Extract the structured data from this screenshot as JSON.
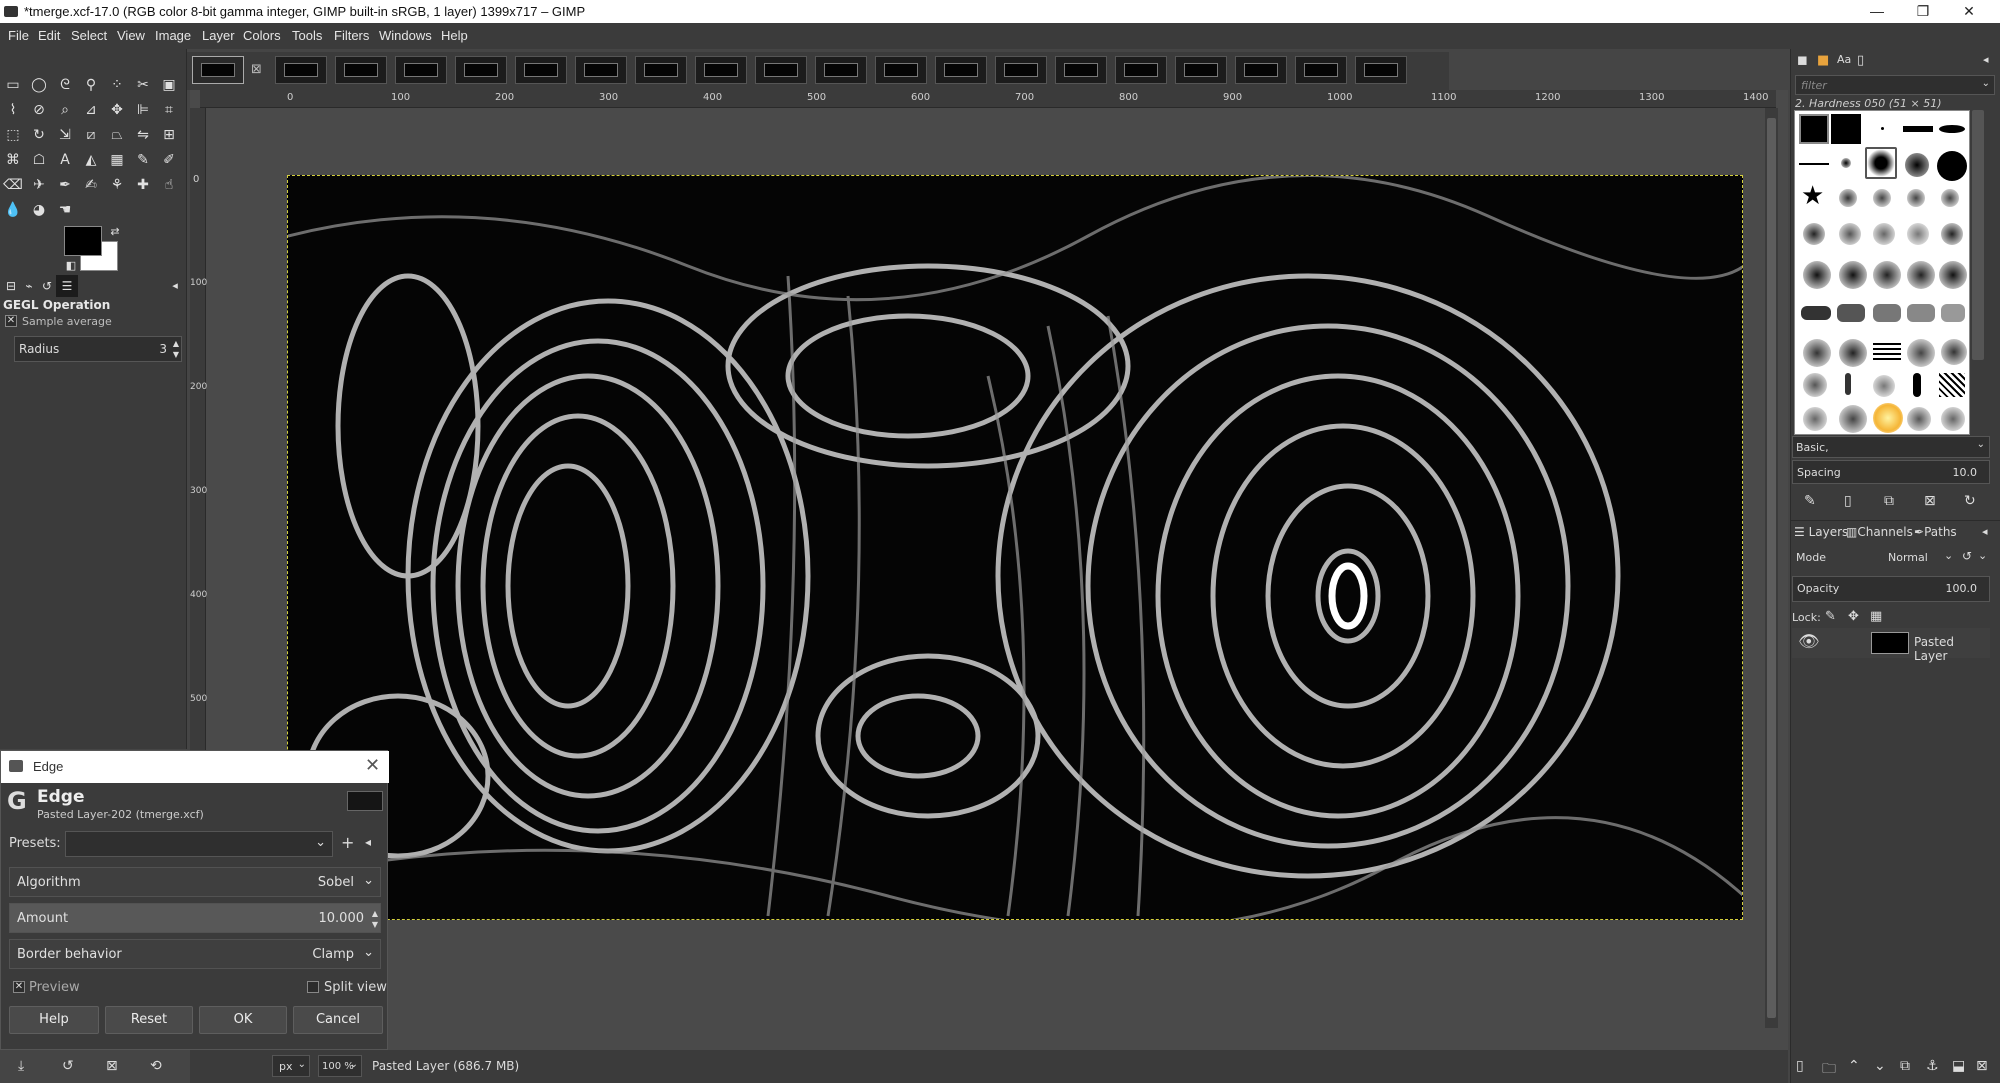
{
  "window": {
    "title": "*tmerge.xcf-17.0 (RGB color 8-bit gamma integer, GIMP built-in sRGB, 1 layer) 1399x717 – GIMP"
  },
  "menubar": [
    "File",
    "Edit",
    "Select",
    "View",
    "Image",
    "Layer",
    "Colors",
    "Tools",
    "Filters",
    "Windows",
    "Help"
  ],
  "ruler": {
    "h": [
      "0",
      "100",
      "200",
      "300",
      "400",
      "500",
      "600",
      "700",
      "800",
      "900",
      "1000",
      "1100",
      "1200",
      "1300",
      "1400"
    ],
    "v": [
      "0",
      "100",
      "200",
      "300",
      "400",
      "500"
    ]
  },
  "tool_options": {
    "title": "GEGL Operation",
    "op": "Sample average",
    "radius_label": "Radius",
    "radius_value": "3"
  },
  "status": {
    "unit": "px",
    "zoom": "100 %",
    "info": "Pasted Layer (686.7 MB)"
  },
  "brushes": {
    "filter_placeholder": "filter",
    "current": "2. Hardness 050 (51 × 51)",
    "preset": "Basic,",
    "spacing_label": "Spacing",
    "spacing_value": "10.0"
  },
  "layers": {
    "tabs": [
      "Layers",
      "Channels",
      "Paths"
    ],
    "mode_label": "Mode",
    "mode_value": "Normal",
    "opacity_label": "Opacity",
    "opacity_value": "100.0",
    "lock_label": "Lock:",
    "layer_name": "Pasted Layer"
  },
  "edge": {
    "window_title": "Edge",
    "heading": "Edge",
    "subtitle": "Pasted Layer-202 (tmerge.xcf)",
    "presets_label": "Presets:",
    "algorithm_label": "Algorithm",
    "algorithm_value": "Sobel",
    "amount_label": "Amount",
    "amount_value": "10.000",
    "border_label": "Border behavior",
    "border_value": "Clamp",
    "preview_label": "Preview",
    "split_label": "Split view",
    "help": "Help",
    "reset": "Reset",
    "ok": "OK",
    "cancel": "Cancel"
  }
}
